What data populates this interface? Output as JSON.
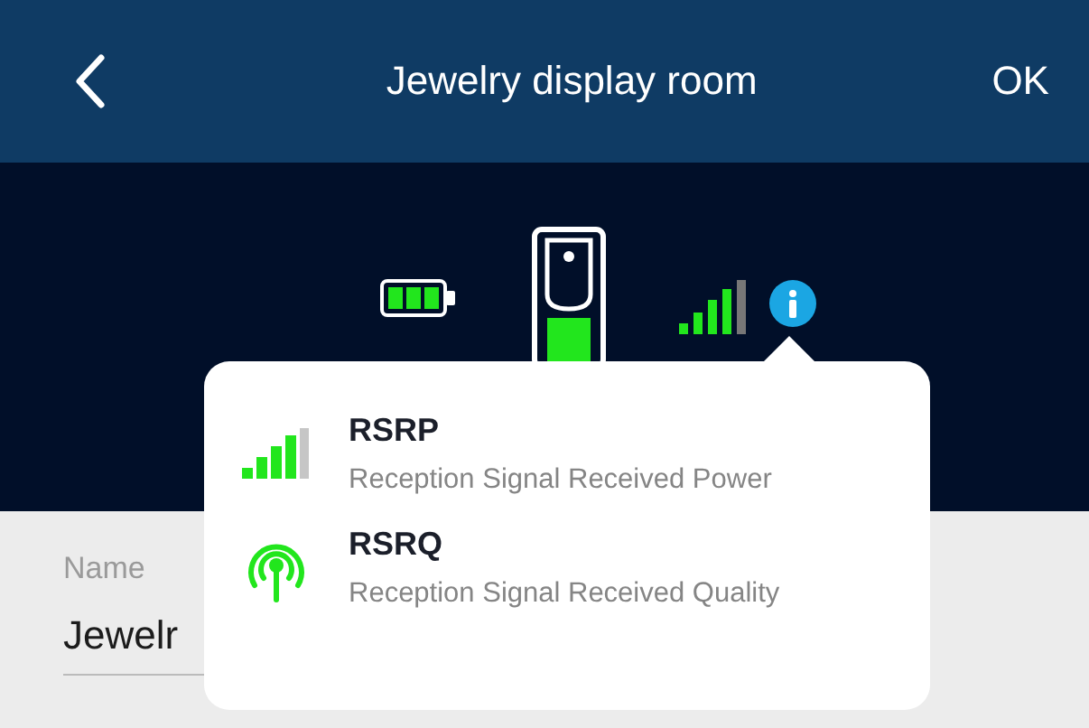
{
  "header": {
    "title": "Jewelry display room",
    "confirm": "OK"
  },
  "legend": [
    {
      "kind": "bars",
      "title": "RSRP",
      "description": "Reception Signal Received Power"
    },
    {
      "kind": "antenna",
      "title": "RSRQ",
      "description": "Reception Signal Received Quality"
    }
  ],
  "name_field": {
    "label": "Name",
    "value": "Jewelr"
  }
}
